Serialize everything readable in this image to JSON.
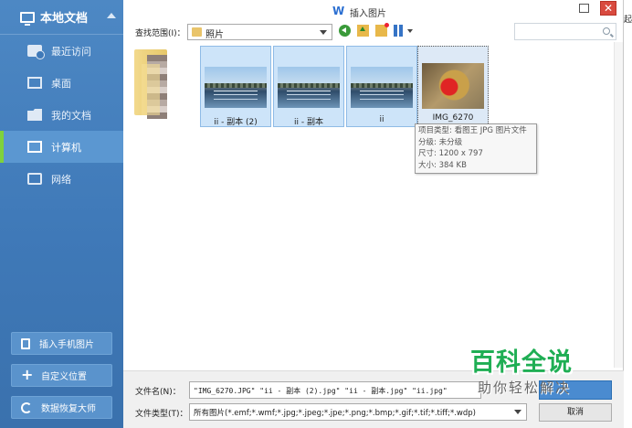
{
  "sidebar": {
    "title": "本地文档",
    "items": [
      {
        "label": "最近访问",
        "icon": "recent-folder-icon"
      },
      {
        "label": "桌面",
        "icon": "desktop-icon"
      },
      {
        "label": "我的文档",
        "icon": "documents-folder-icon"
      },
      {
        "label": "计算机",
        "icon": "computer-icon",
        "active": true
      },
      {
        "label": "网络",
        "icon": "network-icon"
      }
    ],
    "buttons": [
      {
        "label": "插入手机图片",
        "icon": "phone-import-icon"
      },
      {
        "label": "自定义位置",
        "icon": "plus-icon"
      },
      {
        "label": "数据恢复大师",
        "icon": "data-recovery-icon"
      }
    ]
  },
  "dialog": {
    "title": "插入图片",
    "logo": "W",
    "look_in_label": "查找范围(I)：",
    "look_in_value": "照片"
  },
  "files": [
    {
      "name": "ii - 副本 (2)",
      "selected": true
    },
    {
      "name": "ii - 副本",
      "selected": true
    },
    {
      "name": "ii",
      "selected": true
    },
    {
      "name": "IMG_6270",
      "selected": true,
      "focused": true
    }
  ],
  "tooltip": {
    "line1": "项目类型: 看图王 JPG 图片文件",
    "line2": "分级: 未分级",
    "line3": "尺寸: 1200 x 797",
    "line4": "大小: 384 KB"
  },
  "bottom": {
    "filename_label": "文件名(N)：",
    "filename_value": "\"IMG_6270.JPG\" \"ii - 副本 (2).jpg\" \"ii - 副本.jpg\" \"ii.jpg\"",
    "filetype_label": "文件类型(T)：",
    "filetype_value": "所有图片(*.emf;*.wmf;*.jpg;*.jpeg;*.jpe;*.png;*.bmp;*.gif;*.tif;*.tiff;*.wdp)",
    "cancel_label": "取消"
  },
  "watermark": {
    "line1": "百科全说",
    "line2": "助你轻松解决"
  },
  "edge_text": "起",
  "colors": {
    "sidebar_bg": "#4a85c2",
    "active_marker": "#7fd23c",
    "close_button": "#d94a3f",
    "watermark_green": "#1fae54",
    "selection_fill": "#cde4f9"
  }
}
